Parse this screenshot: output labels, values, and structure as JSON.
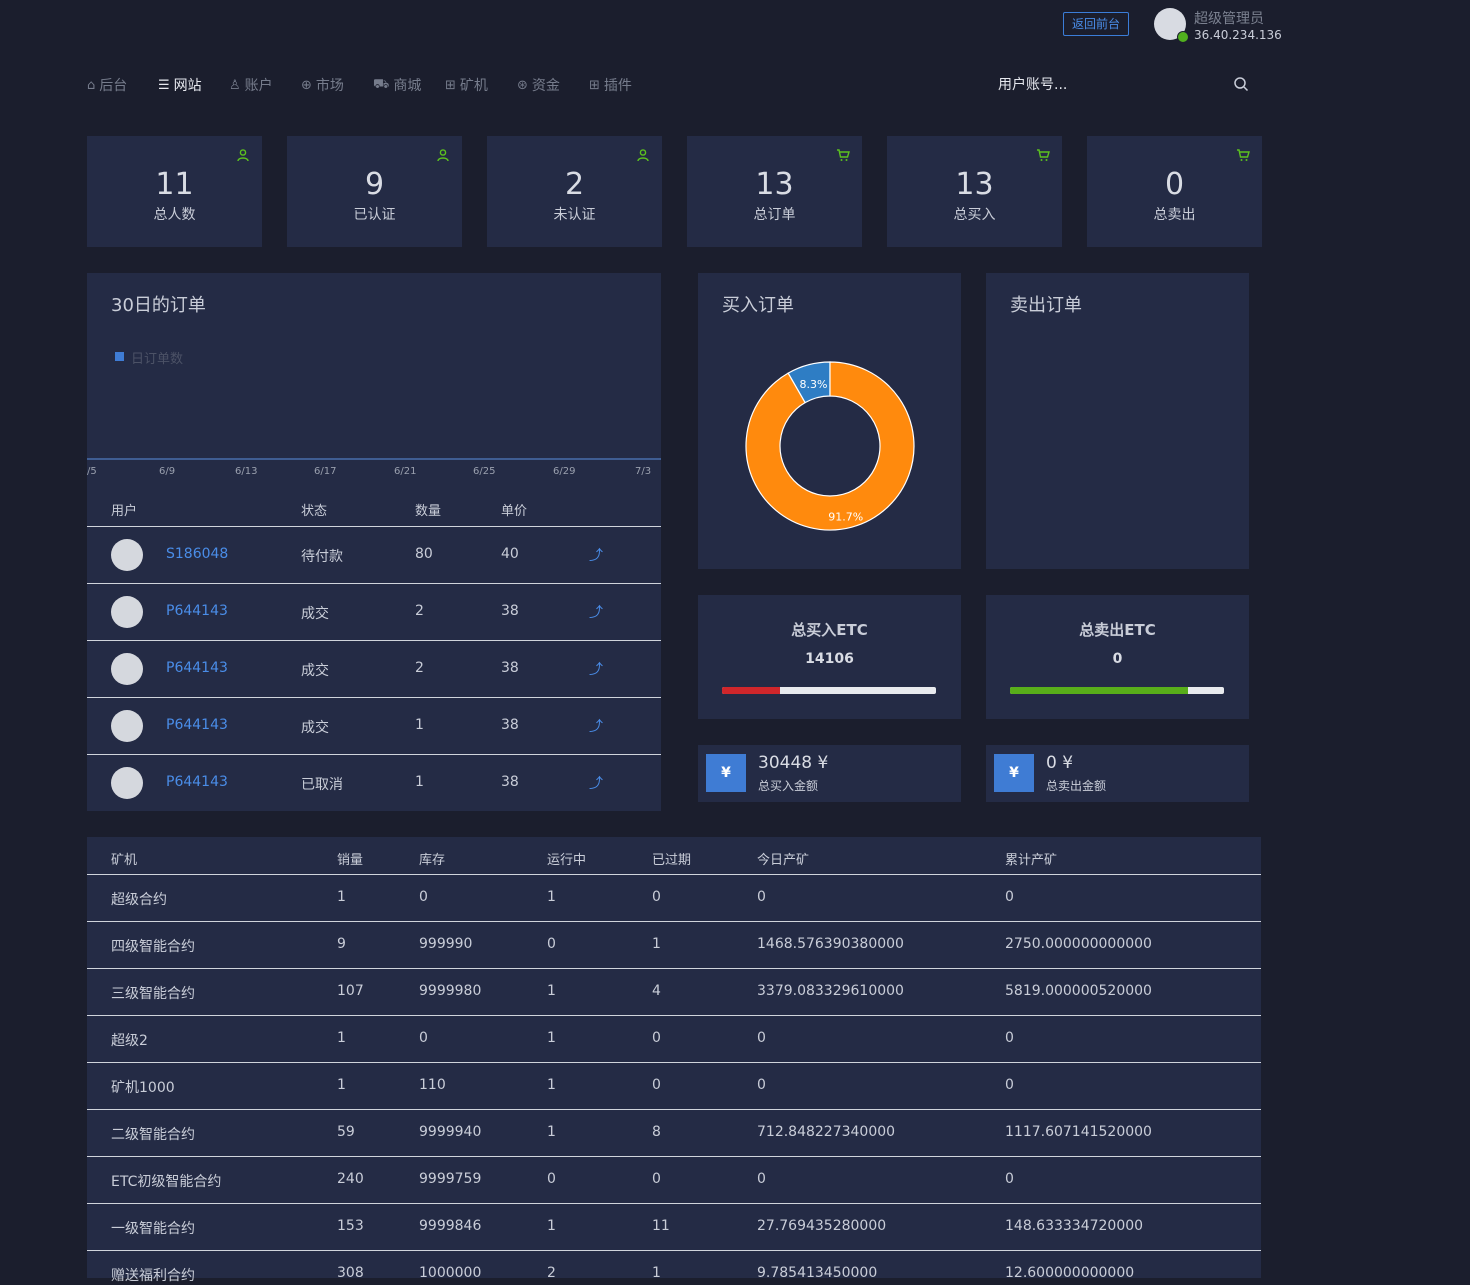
{
  "header": {
    "back_label": "返回前台",
    "user_name": "超级管理员",
    "user_ip": "36.40.234.136"
  },
  "nav": [
    {
      "label": "后台",
      "icon": "home-icon"
    },
    {
      "label": "网站",
      "icon": "list-icon",
      "active": true
    },
    {
      "label": "账户",
      "icon": "users-icon"
    },
    {
      "label": "市场",
      "icon": "globe-icon"
    },
    {
      "label": "商城",
      "icon": "cart-icon"
    },
    {
      "label": "矿机",
      "icon": "chip-icon"
    },
    {
      "label": "资金",
      "icon": "coin-icon"
    },
    {
      "label": "插件",
      "icon": "grid-icon"
    }
  ],
  "search": {
    "placeholder": "用户账号..."
  },
  "stats": [
    {
      "value": "11",
      "label": "总人数",
      "icon": "user-icon"
    },
    {
      "value": "9",
      "label": "已认证",
      "icon": "user-icon"
    },
    {
      "value": "2",
      "label": "未认证",
      "icon": "user-icon"
    },
    {
      "value": "13",
      "label": "总订单",
      "icon": "cart-icon"
    },
    {
      "value": "13",
      "label": "总买入",
      "icon": "cart-icon"
    },
    {
      "value": "0",
      "label": "总卖出",
      "icon": "cart-icon"
    }
  ],
  "orders_panel": {
    "title": "30日的订单",
    "legend": "日订单数",
    "columns": [
      "用户",
      "状态",
      "数量",
      "单价"
    ],
    "rows": [
      {
        "user": "S186048",
        "status": "待付款",
        "qty": "80",
        "price": "40"
      },
      {
        "user": "P644143",
        "status": "成交",
        "qty": "2",
        "price": "38"
      },
      {
        "user": "P644143",
        "status": "成交",
        "qty": "2",
        "price": "38"
      },
      {
        "user": "P644143",
        "status": "成交",
        "qty": "1",
        "price": "38"
      },
      {
        "user": "P644143",
        "status": "已取消",
        "qty": "1",
        "price": "38"
      }
    ]
  },
  "chart_data": [
    {
      "type": "line",
      "title": "30日的订单",
      "series": [
        {
          "name": "日订单数",
          "values": []
        }
      ],
      "x_ticks": [
        "/5",
        "6/9",
        "6/13",
        "6/17",
        "6/21",
        "6/25",
        "6/29",
        "7/3"
      ],
      "legend_position": "top-left"
    },
    {
      "type": "pie",
      "title": "买入订单",
      "slices": [
        {
          "label": "91.7%",
          "value": 91.7,
          "color": "#ff8a0d"
        },
        {
          "label": "8.3%",
          "value": 8.3,
          "color": "#2e7dc4"
        }
      ]
    }
  ],
  "buy_panel": {
    "title": "买入订单"
  },
  "sell_panel": {
    "title": "卖出订单"
  },
  "buy_total": {
    "title": "总买入ETC",
    "value": "14106",
    "progress": 0.27,
    "color": "#d0262b"
  },
  "sell_total": {
    "title": "总卖出ETC",
    "value": "0",
    "progress": 0.83,
    "color": "#58ae1a"
  },
  "buy_amount": {
    "icon": "¥",
    "value": "30448 ¥",
    "label": "总买入金额"
  },
  "sell_amount": {
    "icon": "¥",
    "value": "0 ¥",
    "label": "总卖出金额"
  },
  "miners": {
    "columns": [
      "矿机",
      "销量",
      "库存",
      "运行中",
      "已过期",
      "今日产矿",
      "累计产矿"
    ],
    "rows": [
      [
        "超级合约",
        "1",
        "0",
        "1",
        "0",
        "0",
        "0"
      ],
      [
        "四级智能合约",
        "9",
        "999990",
        "0",
        "1",
        "1468.576390380000",
        "2750.000000000000"
      ],
      [
        "三级智能合约",
        "107",
        "9999980",
        "1",
        "4",
        "3379.083329610000",
        "5819.000000520000"
      ],
      [
        "超级2",
        "1",
        "0",
        "1",
        "0",
        "0",
        "0"
      ],
      [
        "矿机1000",
        "1",
        "110",
        "1",
        "0",
        "0",
        "0"
      ],
      [
        "二级智能合约",
        "59",
        "9999940",
        "1",
        "8",
        "712.848227340000",
        "1117.607141520000"
      ],
      [
        "ETC初级智能合约",
        "240",
        "9999759",
        "0",
        "0",
        "0",
        "0"
      ],
      [
        "一级智能合约",
        "153",
        "9999846",
        "1",
        "11",
        "27.769435280000",
        "148.633334720000"
      ],
      [
        "赠送福利合约",
        "308",
        "1000000",
        "2",
        "1",
        "9.785413450000",
        "12.600000000000"
      ]
    ]
  }
}
